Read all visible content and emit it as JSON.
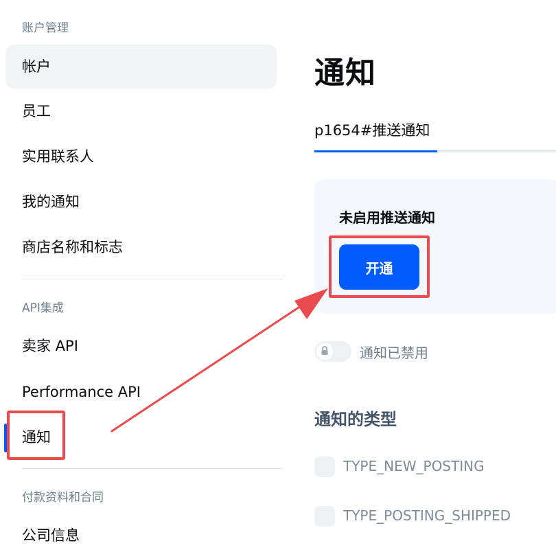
{
  "sidebar": {
    "groups": [
      {
        "title": "账户管理",
        "items": [
          {
            "label": "帐户"
          },
          {
            "label": "员工"
          },
          {
            "label": "实用联系人"
          },
          {
            "label": "我的通知"
          },
          {
            "label": "商店名称和标志"
          }
        ]
      },
      {
        "title": "API集成",
        "items": [
          {
            "label": "卖家 API"
          },
          {
            "label": "Performance API"
          },
          {
            "label": "通知"
          }
        ]
      },
      {
        "title": "付款资料和合同",
        "items": [
          {
            "label": "公司信息"
          }
        ]
      }
    ]
  },
  "main": {
    "title": "通知",
    "tab_label": "p1654#推送通知",
    "card": {
      "title": "未启用推送通知",
      "button_label": "开通"
    },
    "toggle_label": "通知已禁用",
    "types_title": "通知的类型",
    "types": [
      {
        "label": "TYPE_NEW_POSTING"
      },
      {
        "label": "TYPE_POSTING_SHIPPED"
      }
    ]
  },
  "colors": {
    "accent": "#005bff",
    "annotation": "#ea4b4f",
    "selected_bg": "#f2f3f5",
    "card_bg": "#f4f7fb"
  },
  "icons": {
    "toggle_lock": "lock-icon",
    "annotation_arrow": "arrow"
  }
}
